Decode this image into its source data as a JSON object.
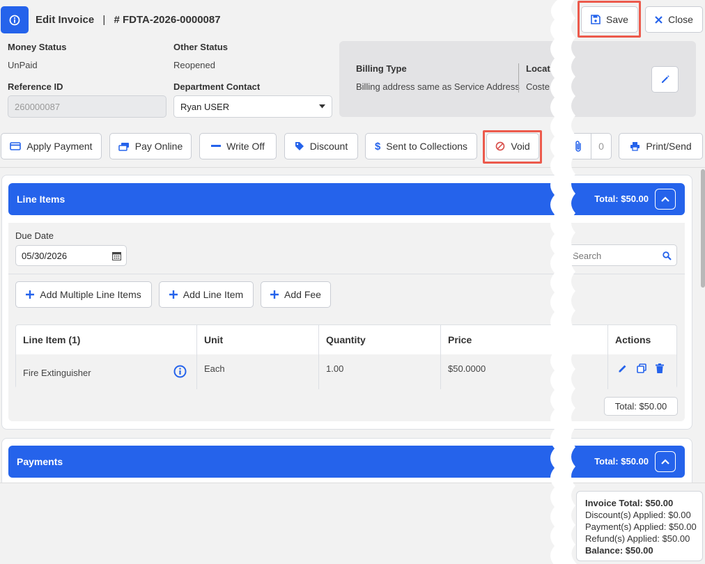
{
  "header": {
    "title": "Edit Invoice",
    "separator": "|",
    "invoice_number": "# FDTA-2026-0000087"
  },
  "toolbar": {
    "save_label": "Save",
    "close_label": "Close"
  },
  "details": {
    "money_status_label": "Money Status",
    "money_status_value": "UnPaid",
    "other_status_label": "Other Status",
    "other_status_value": "Reopened",
    "reference_id_label": "Reference ID",
    "reference_id_value": "260000087",
    "department_contact_label": "Department Contact",
    "department_contact_value": "Ryan USER",
    "billing_type_label": "Billing Type",
    "billing_type_value": "Billing address same as Service Address",
    "location_label": "Locati",
    "location_value": "Coste"
  },
  "actions": {
    "apply_payment": "Apply Payment",
    "pay_online": "Pay Online",
    "write_off": "Write Off",
    "discount": "Discount",
    "sent_to_collections": "Sent to Collections",
    "void": "Void",
    "attachments_count": "0",
    "print_send": "Print/Send"
  },
  "line_items": {
    "title": "Line Items",
    "total": "Total: $50.00",
    "due_date_label": "Due Date",
    "due_date_value": "05/30/2026",
    "search_placeholder": "Search",
    "add_multiple": "Add Multiple Line Items",
    "add_line_item": "Add Line Item",
    "add_fee": "Add Fee",
    "columns": [
      "Line Item (1)",
      "Unit",
      "Quantity",
      "Price",
      "Actions"
    ],
    "rows": [
      {
        "name": "Fire Extinguisher",
        "unit": "Each",
        "quantity": "1.00",
        "price": "$50.0000"
      }
    ],
    "footer_total": "Total: $50.00"
  },
  "payments": {
    "title": "Payments",
    "total": "Total: $50.00"
  },
  "summary": {
    "invoice_total": "Invoice Total: $50.00",
    "discounts": "Discount(s) Applied: $0.00",
    "payments": "Payment(s) Applied: $50.00",
    "refunds": "Refund(s) Applied: $50.00",
    "balance": "Balance: $50.00"
  },
  "colors": {
    "primary": "#2563eb",
    "highlight": "#ec5a4c",
    "panel": "#f2f2f2"
  }
}
